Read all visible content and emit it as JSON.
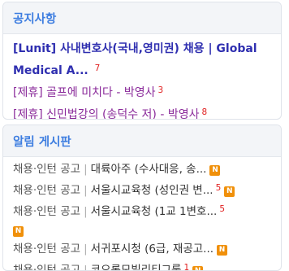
{
  "notice": {
    "title": "공지사항",
    "items": [
      {
        "line1": "[Lunit] 사내변호사(국내,영미권) 채용 | Global",
        "line2": "Medical A...",
        "count": "7"
      },
      {
        "text": "[제휴] 골프에 미치다 - 박영사",
        "count": "3"
      },
      {
        "text": "[제휴] 신민법강의 (송덕수 저) - 박영사",
        "count": "8"
      }
    ]
  },
  "board": {
    "title": "알림 게시판",
    "badge": "N",
    "items": [
      {
        "category": "채용·인턴 공고",
        "text": "대륙아주 (수사대응, 송...",
        "count": ""
      },
      {
        "category": "채용·인턴 공고",
        "text": "서울시교육청 (성인권 변...",
        "count": "5"
      },
      {
        "category": "채용·인턴 공고",
        "text": "서울시교육청 (1교 1변호...",
        "count": "5"
      },
      {
        "category": "채용·인턴 공고",
        "text": "서귀포시청 (6급, 재공고...",
        "count": ""
      },
      {
        "category": "채용·인턴 공고",
        "text": "코오롱모빌리티그룹",
        "count": "1"
      }
    ]
  }
}
